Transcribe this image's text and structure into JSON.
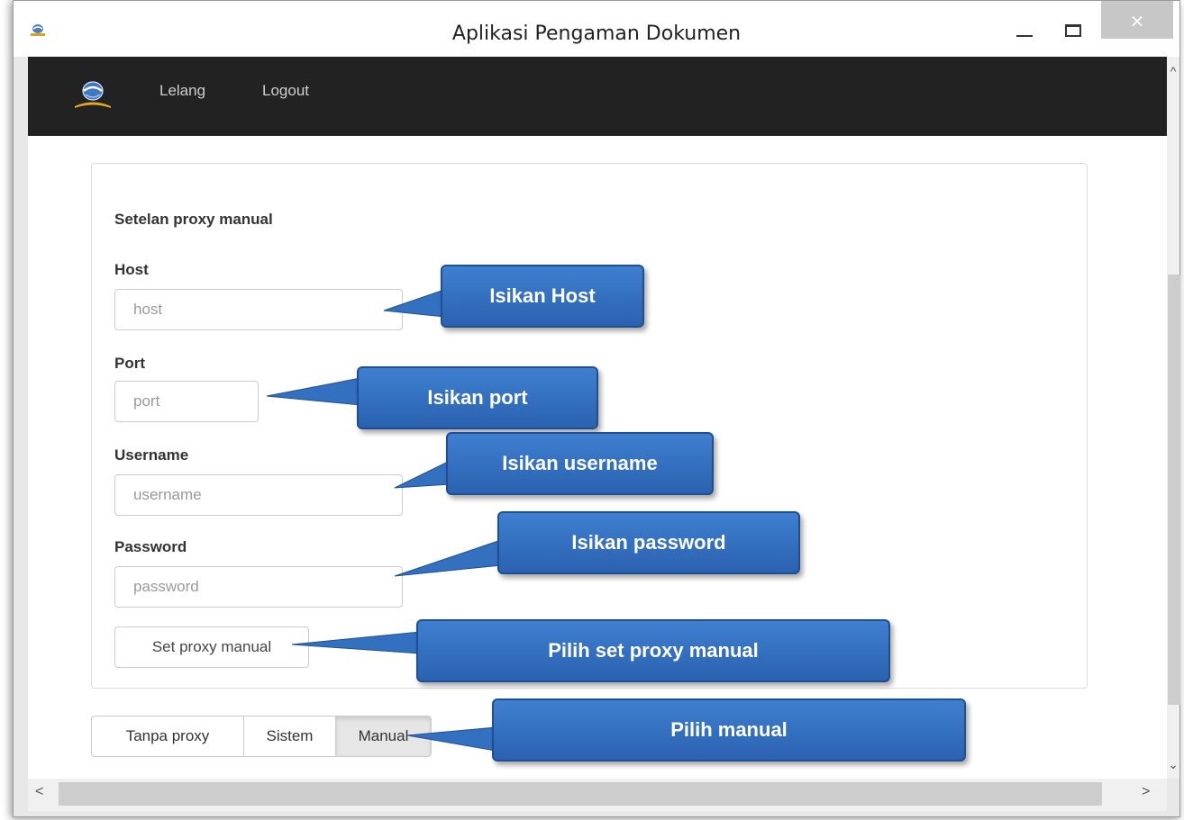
{
  "window": {
    "title": "Aplikasi Pengaman Dokumen",
    "close_glyph": "×"
  },
  "navbar": {
    "links": [
      "Lelang",
      "Logout"
    ]
  },
  "panel": {
    "heading": "Setelan proxy manual",
    "host": {
      "label": "Host",
      "placeholder": "host"
    },
    "port": {
      "label": "Port",
      "placeholder": "port"
    },
    "username": {
      "label": "Username",
      "placeholder": "username"
    },
    "password": {
      "label": "Password",
      "placeholder": "password"
    },
    "submit_label": "Set proxy manual"
  },
  "proxy_modes": {
    "options": [
      "Tanpa proxy",
      "Sistem",
      "Manual"
    ],
    "selected": "Manual"
  },
  "scroll": {
    "up": "^",
    "down": "⌄",
    "left": "<",
    "right": ">"
  },
  "callouts": {
    "host": "Isikan Host",
    "port": "Isikan port",
    "username": "Isikan username",
    "password": "Isikan password",
    "set_proxy": "Pilih set proxy manual",
    "manual": "Pilih manual"
  },
  "colors": {
    "navbar_bg": "#222222",
    "callout_bg": "#3470c0",
    "callout_border": "#1f4f92",
    "selected_mode_bg": "#e6e6e6"
  }
}
